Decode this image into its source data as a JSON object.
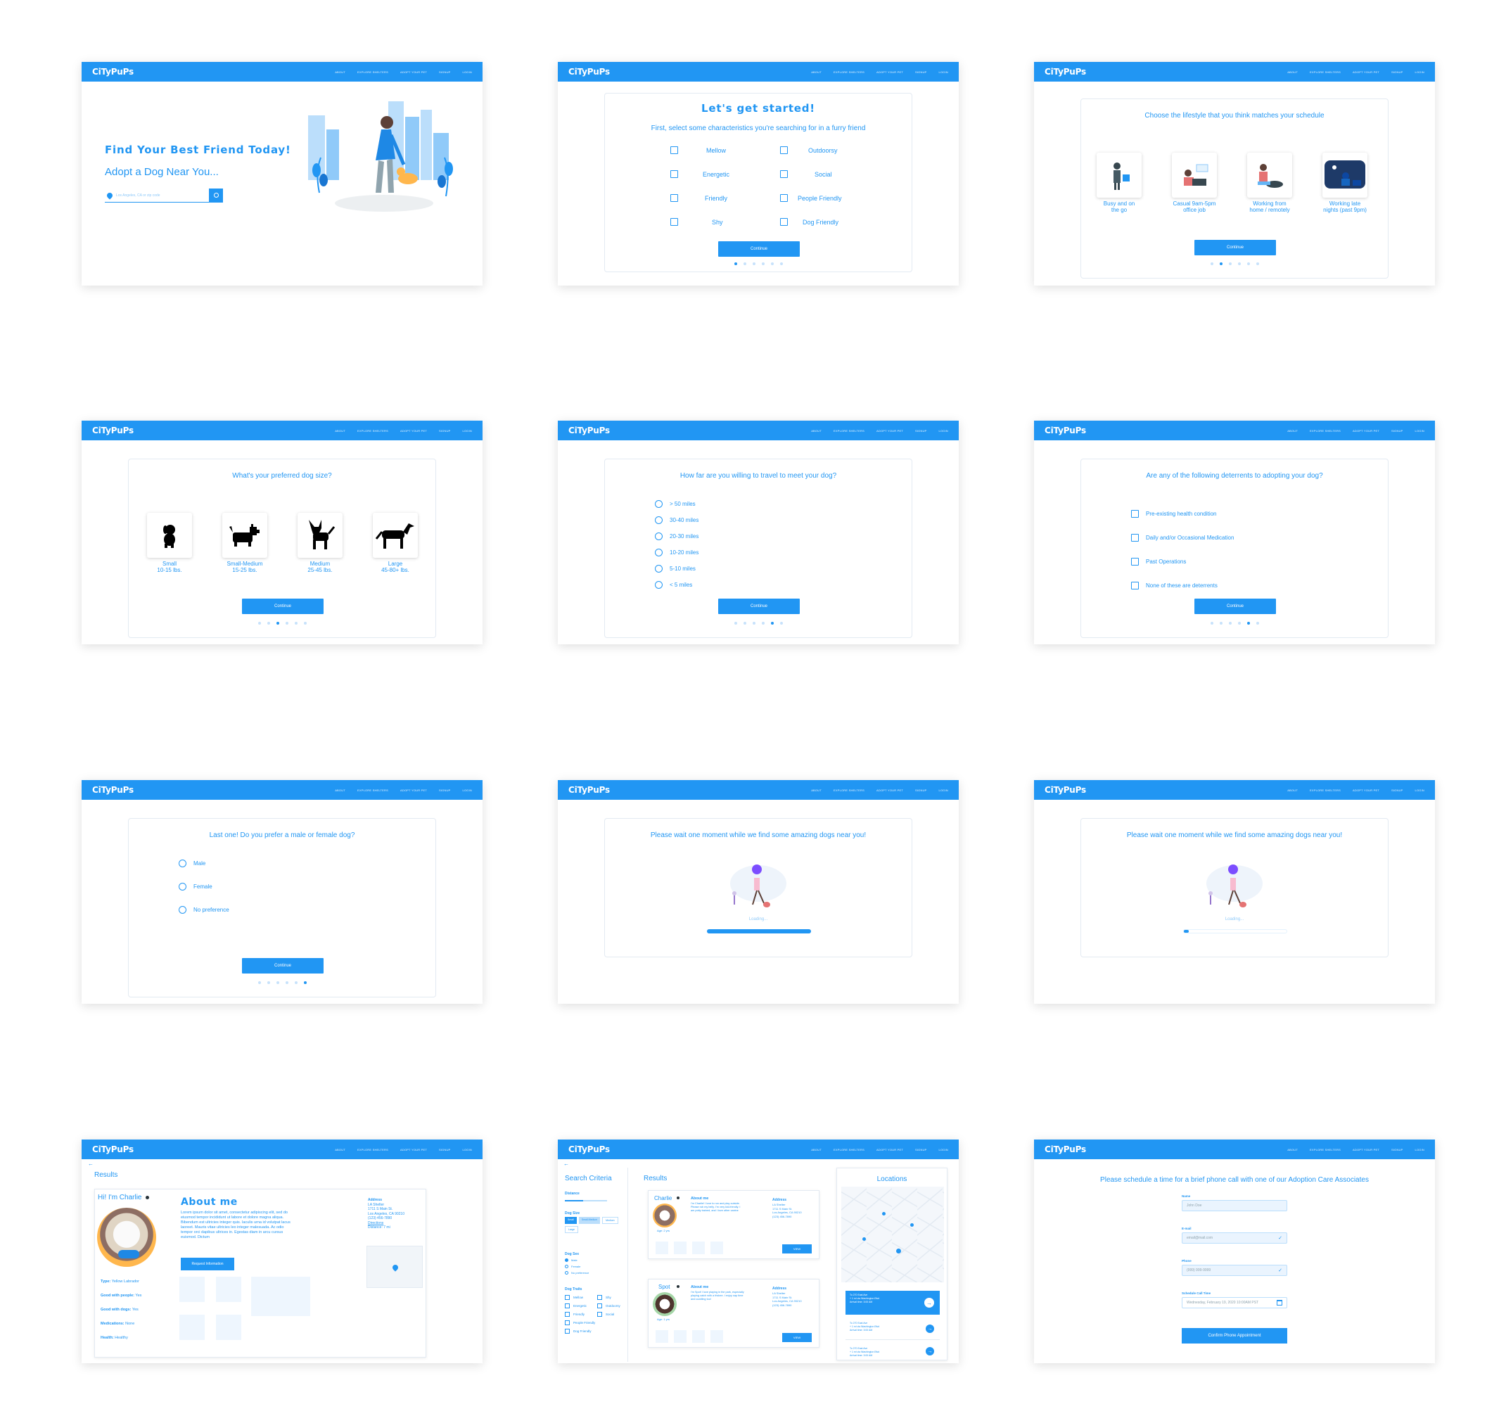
{
  "nav": {
    "logo": "CiTyPuPs",
    "links": [
      "ABOUT",
      "EXPLORE SHELTERS",
      "ADOPT YOUR PET",
      "SIGNUP",
      "LOGIN"
    ]
  },
  "home": {
    "headline": "Find Your Best Friend Today!",
    "subheadline": "Adopt a Dog Near You...",
    "search_placeholder": "Los Angeles, CA or zip code"
  },
  "characteristics": {
    "title": "Let's get started!",
    "subtitle": "First, select some characteristics you're searching for in a furry friend",
    "options_left": [
      "Mellow",
      "Energetic",
      "Friendly",
      "Shy"
    ],
    "options_right": [
      "Outdoorsy",
      "Social",
      "People Friendly",
      "Dog Friendly"
    ],
    "button": "Continue"
  },
  "lifestyle": {
    "title": "Choose the lifestyle that you think matches your schedule",
    "options": [
      {
        "line1": "Busy and on",
        "line2": "the go"
      },
      {
        "line1": "Casual 9am-5pm",
        "line2": "office job"
      },
      {
        "line1": "Working from",
        "line2": "home / remotely"
      },
      {
        "line1": "Working late",
        "line2": "nights (past 9pm)"
      }
    ],
    "button": "Continue"
  },
  "size": {
    "title": "What's your preferred dog size?",
    "options": [
      {
        "name": "Small",
        "weight": "10-15 lbs."
      },
      {
        "name": "Small-Medium",
        "weight": "15-25 lbs."
      },
      {
        "name": "Medium",
        "weight": "25-45 lbs."
      },
      {
        "name": "Large",
        "weight": "45-80+ lbs."
      }
    ],
    "button": "Continue"
  },
  "distance": {
    "title": "How far are you willing to travel to meet your dog?",
    "options": [
      "> 50 miles",
      "30-40 miles",
      "20-30 miles",
      "10-20 miles",
      "5-10 miles",
      "< 5 miles"
    ],
    "button": "Continue"
  },
  "deterrents": {
    "title": "Are any of the following deterrents to adopting your dog?",
    "options": [
      "Pre-existing health condition",
      "Daily and/or Occasional Medication",
      "Past Operations",
      "None of these are deterrents"
    ],
    "button": "Continue"
  },
  "gender": {
    "title": "Last one! Do you prefer a male or female dog?",
    "options": [
      "Male",
      "Female",
      "No preference"
    ],
    "button": "Continue"
  },
  "loading": {
    "title": "Please wait one moment while we find some amazing dogs near you!",
    "label": "Loading...",
    "progress_a": 1.0,
    "progress_b": 0.05
  },
  "profile": {
    "back": "Results",
    "greeting": "Hi! I'm Charlie",
    "about_title": "About me",
    "about_text": "Lorem ipsum dolor sit amet, consectetur adipiscing elit, sed do eiusmod tempor incididunt ut labore et dolore magna aliqua. Bibendum est ultricies integer quis. Iaculis urna id volutpat lacus laoreet. Mauris vitae ultricies leo integer malesuada. Ac odio tempor orci dapibus ultrices in. Egestas diam in arcu cursus euismod. Dictum",
    "request_button": "Request Information",
    "facts": [
      {
        "k": "Type:",
        "v": "Yellow Labrador"
      },
      {
        "k": "Good with people:",
        "v": "Yes"
      },
      {
        "k": "Good with dogs:",
        "v": "Yes"
      },
      {
        "k": "Medications:",
        "v": "None"
      },
      {
        "k": "Health:",
        "v": "Healthy"
      }
    ],
    "address_title": "Address",
    "address_lines": [
      "LA Shelter",
      "1711 S Main St.",
      "Los Angeles, CA 90210",
      "(123) 456-7890"
    ],
    "directions": "Directions",
    "distance": "Distance: 7 mi"
  },
  "results": {
    "criteria_title": "Search Criteria",
    "results_title": "Results",
    "locations_title": "Locations",
    "distance_label": "Distance",
    "dog_size_label": "Dog Size",
    "size_chips": [
      "Small",
      "Small-Medium",
      "Medium",
      "Large"
    ],
    "dog_sex_label": "Dog Sex",
    "sex_options": [
      "Male",
      "Female",
      "No preference"
    ],
    "traits_label": "Dog Traits",
    "traits_left": [
      "Mellow",
      "Energetic",
      "Friendly",
      "People Friendly",
      "Dog Friendly"
    ],
    "traits_right": [
      "Shy",
      "Outdoorsy",
      "Social"
    ],
    "dogs": [
      {
        "name": "Charlie",
        "age": "Age: 2 yrs",
        "about_title": "About me",
        "about": "I'm Charlie! I love to run and play outside. Please rub my belly. I'm very kid-friendly. I am potty trained, and I love other canine",
        "address_title": "Address",
        "address": [
          "LA Shelter",
          "1711 S Main St.",
          "Los Angeles, CA 90210",
          "(123) 456-7890"
        ],
        "button": "VIEW"
      },
      {
        "name": "Spot",
        "age": "Age: 1 yrs",
        "about_title": "About me",
        "about": "I'm Spot! I love playing in the park, especially playing catch with a frisbee. I enjoy nap time and cuddling too!",
        "address_title": "Address",
        "address": [
          "LA Shelter",
          "1711 S Main St.",
          "Los Angeles, CA 90210",
          "(123) 456-7890"
        ],
        "button": "VIEW"
      }
    ],
    "routes": [
      {
        "l1": "To 270 East Ave",
        "l2": "+ 1 mi via Washington Blvd",
        "l3": "Arrival time: 3:00 AM"
      },
      {
        "l1": "To 270 East Ave",
        "l2": "+ 1 mi via Washington Blvd",
        "l3": "Arrival time: 3:00 AM"
      },
      {
        "l1": "To 270 East Ave",
        "l2": "+ 1 mi via Washington Blvd",
        "l3": "Arrival time: 3:00 AM"
      }
    ]
  },
  "schedule": {
    "title": "Please schedule a time for a brief phone call with one of our Adoption Care Associates",
    "name_label": "Name",
    "name_value": "John Doe",
    "email_label": "E-mail",
    "email_value": "email@mail.com",
    "phone_label": "Phone",
    "phone_value": "(999) 999-9999",
    "time_label": "Schedule Call Time",
    "time_value": "Wednesday, February 19, 2020 10:00AM PST",
    "button": "Confirm Phone Appointment"
  },
  "colors": {
    "primary": "#2196f3",
    "light": "#e3f2fd"
  }
}
